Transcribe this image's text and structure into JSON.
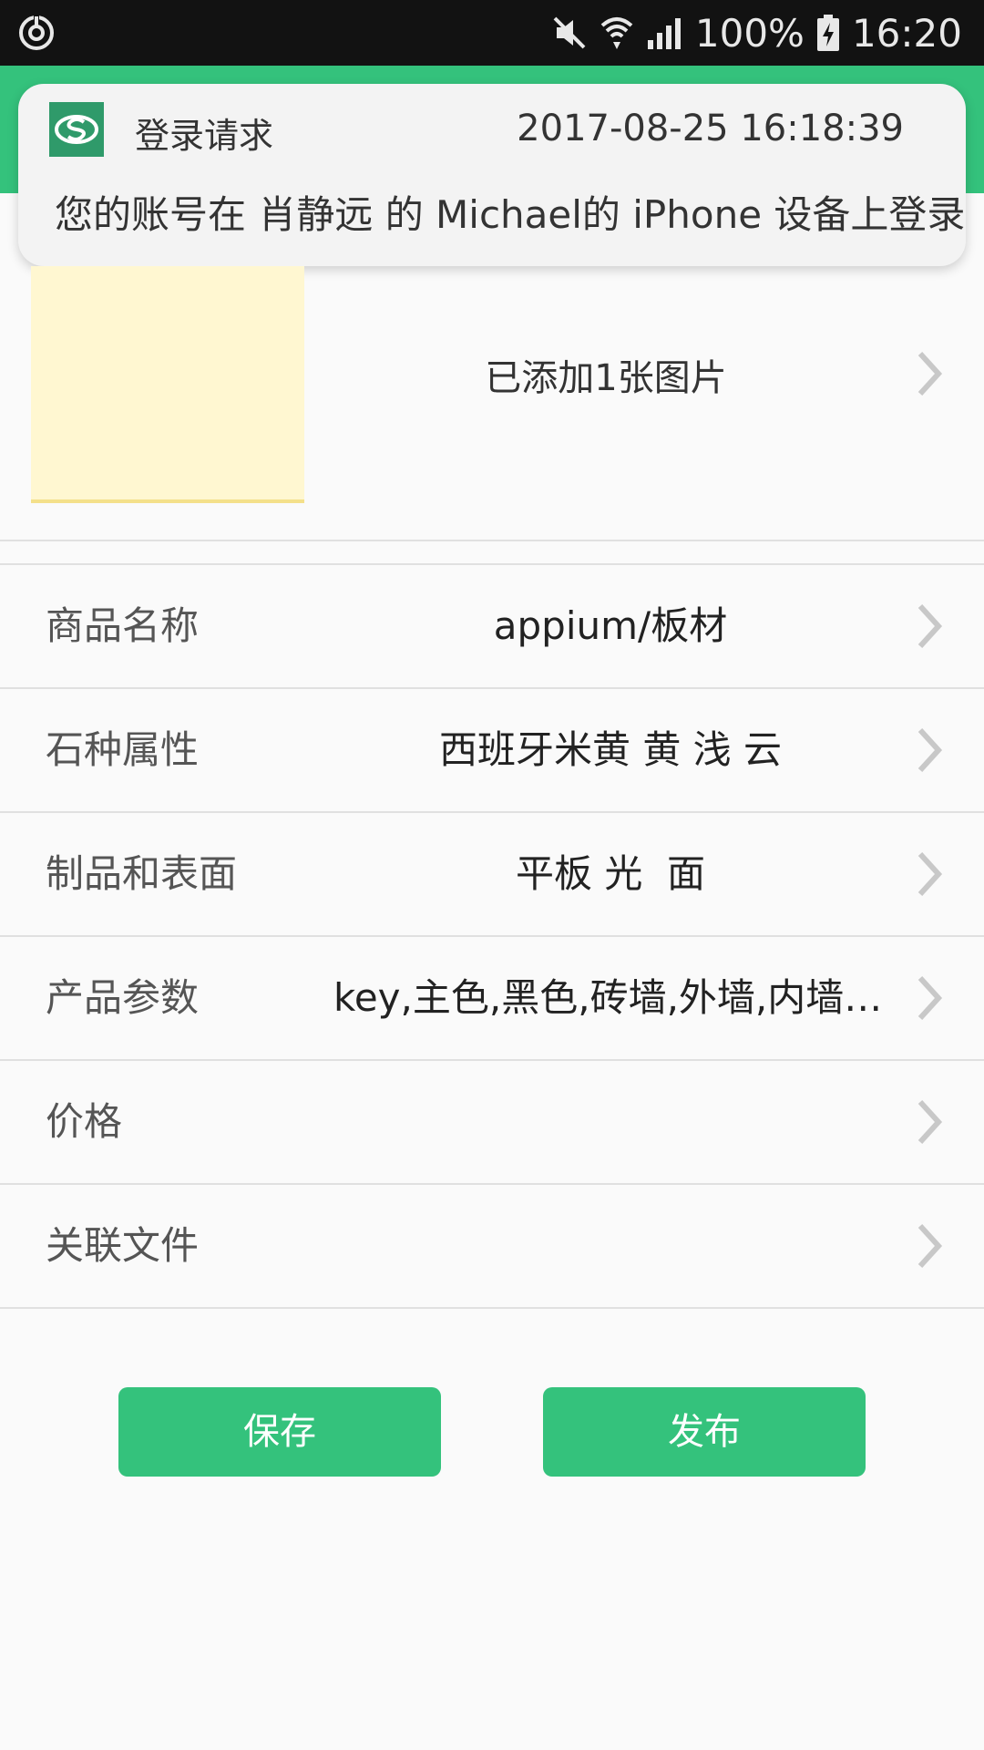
{
  "status_bar": {
    "battery": "100%",
    "time": "16:20"
  },
  "notification": {
    "title": "登录请求",
    "time": "2017-08-25 16:18:39",
    "body": "您的账号在 肖静远 的 Michael的 iPhone 设备上登录"
  },
  "images": {
    "label": "已添加1张图片"
  },
  "fields": [
    {
      "label": "商品名称",
      "value": "appium/板材"
    },
    {
      "label": "石种属性",
      "value": "西班牙米黄 黄 浅 云"
    },
    {
      "label": "制品和表面",
      "value": "平板 光  面"
    },
    {
      "label": "产品参数",
      "value": "key,主色,黑色,砖墙,外墙,内墙,地面"
    },
    {
      "label": "价格",
      "value": ""
    },
    {
      "label": "关联文件",
      "value": ""
    }
  ],
  "buttons": {
    "save": "保存",
    "publish": "发布"
  },
  "colors": {
    "accent": "#34c27c",
    "status_bar": "#121212",
    "background": "#fafafa"
  }
}
